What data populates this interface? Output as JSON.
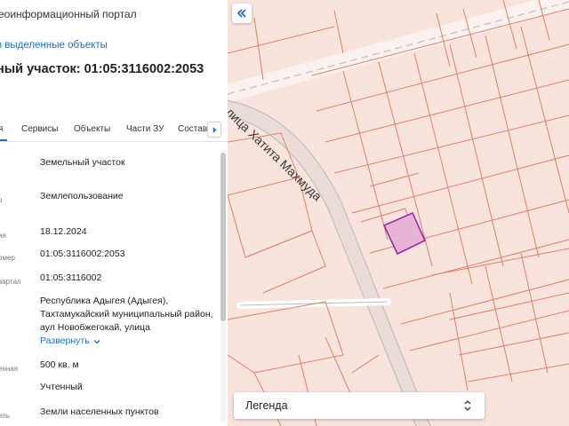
{
  "header": {
    "portal_title": "еоинформационный портал",
    "back_link": "в выделенные объекты",
    "parcel_title": "ный участок: 01:05:3116002:2053"
  },
  "tabs": [
    {
      "label": "я",
      "active": true
    },
    {
      "label": "Сервисы"
    },
    {
      "label": "Объекты"
    },
    {
      "label": "Части ЗУ"
    },
    {
      "label": "Состав"
    }
  ],
  "rows": [
    {
      "key": "",
      "value": "Земельный участок"
    },
    {
      "key": "о",
      "value": "Землепользование"
    },
    {
      "key": "ия",
      "value": "18.12.2024"
    },
    {
      "key": "омер",
      "value": "01:05:3116002:2053"
    },
    {
      "key": "вартал",
      "value": "01:05:3116002"
    },
    {
      "key": "",
      "value": "Республика Адыгея (Адыгея), Тахтамукайский муниципальный район, аул Новобжегокай, улица",
      "expand_label": "Развернуть"
    },
    {
      "key": "енная",
      "value": "500 кв. м"
    },
    {
      "key": "",
      "value": "Учтенный"
    },
    {
      "key": "ель",
      "value": "Земли населенных пунктов"
    }
  ],
  "map": {
    "street_label": "лица Хатита Махмуда",
    "legend_label": "Легенда",
    "parcel_color": "#e7b4d6",
    "parcel_stroke": "#9c27b0",
    "line_color": "#e0806a",
    "background": "#f8e3dd"
  },
  "icons": {
    "collapse": "double-chevron-left-icon",
    "tabs_next": "chevron-right-icon",
    "expand": "chevron-down-icon",
    "legend_select": "select-arrows-icon"
  }
}
